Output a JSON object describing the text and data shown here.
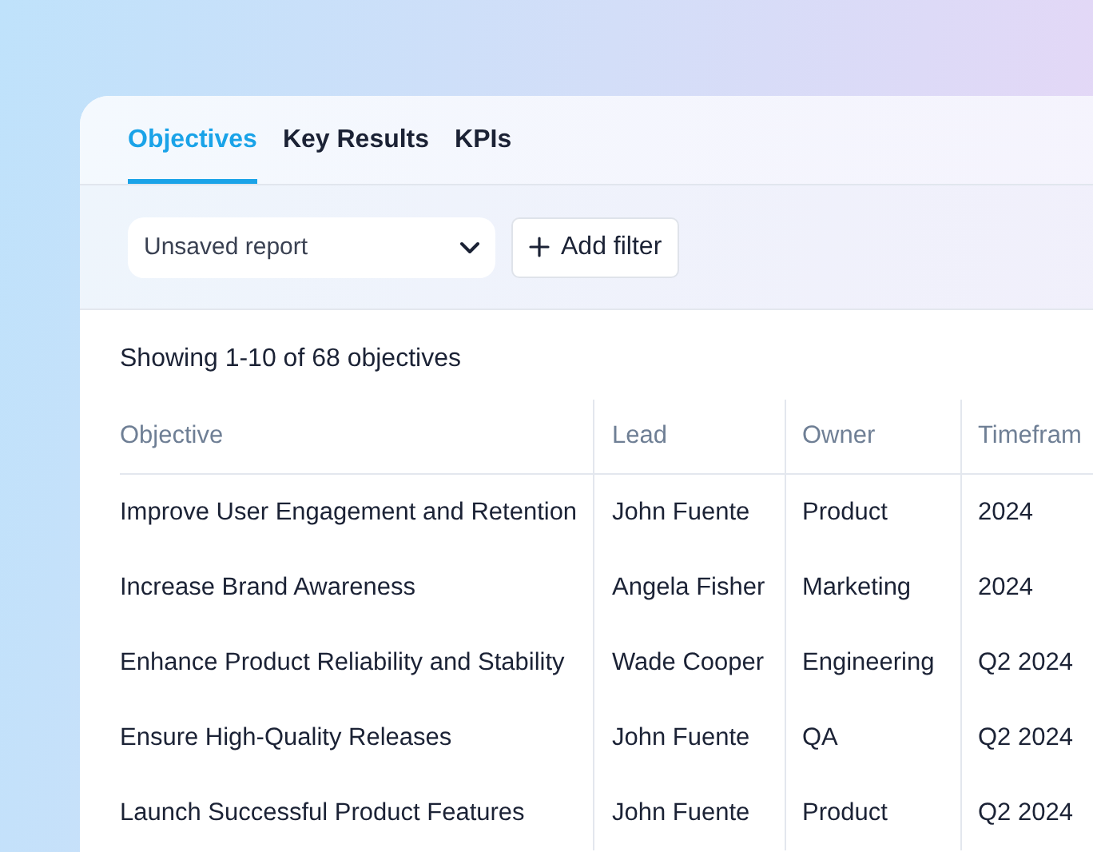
{
  "tabs": [
    {
      "label": "Objectives",
      "selected": true
    },
    {
      "label": "Key Results",
      "selected": false
    },
    {
      "label": "KPIs",
      "selected": false
    }
  ],
  "toolbar": {
    "report_select": "Unsaved report",
    "add_filter": "Add filter"
  },
  "summary": "Showing 1-10 of 68 objectives",
  "table": {
    "columns": [
      "Objective",
      "Lead",
      "Owner",
      "Timefram"
    ],
    "rows": [
      [
        "Improve User Engagement and Retention",
        "John Fuente",
        "Product",
        "2024"
      ],
      [
        "Increase Brand Awareness",
        "Angela Fisher",
        "Marketing",
        "2024"
      ],
      [
        "Enhance Product Reliability and Stability",
        "Wade Cooper",
        "Engineering",
        "Q2 2024"
      ],
      [
        "Ensure High-Quality Releases",
        "John Fuente",
        "QA",
        "Q2 2024"
      ],
      [
        "Launch Successful Product Features",
        "John Fuente",
        "Product",
        "Q2 2024"
      ]
    ]
  }
}
